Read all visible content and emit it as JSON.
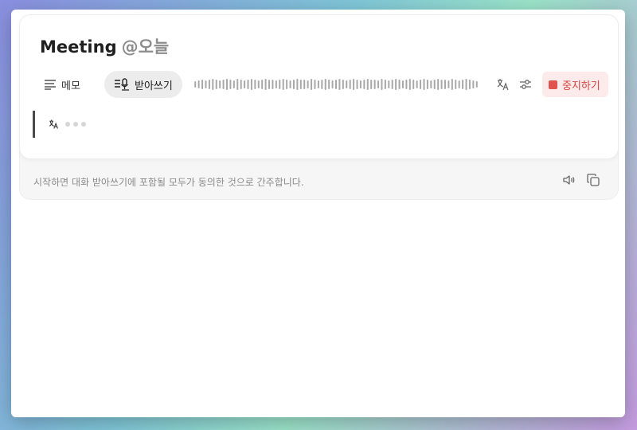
{
  "header": {
    "title": "Meeting",
    "date_tag": "@오늘"
  },
  "toolbar": {
    "memo_label": "메모",
    "transcribe_label": "받아쓰기",
    "stop_label": "중지하기",
    "waveform_icon": "audio-waveform",
    "language_icon": "language-icon",
    "settings_icon": "sliders-icon"
  },
  "transcript": {
    "status": "listening"
  },
  "notice": {
    "text": "시작하면 대화 받아쓰기에 포함될 모두가 동의한 것으로 간주합니다."
  },
  "colors": {
    "stop_accent": "#e0544f",
    "stop_background": "#fdeaea",
    "active_tab_background": "#ececec"
  }
}
